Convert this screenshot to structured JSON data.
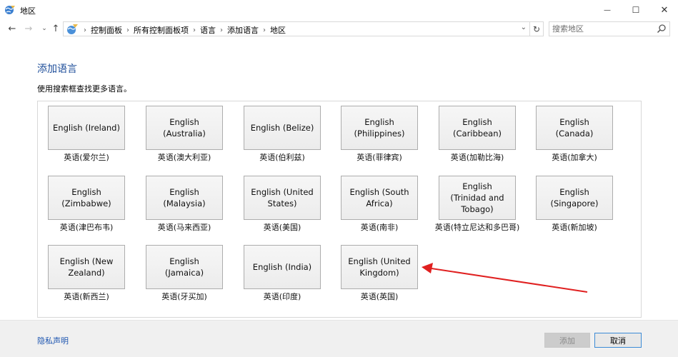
{
  "window": {
    "title": "地区",
    "minimize_glyph": "—",
    "maximize_glyph": "☐",
    "close_glyph": "✕"
  },
  "address_bar": {
    "breadcrumbs": [
      "控制面板",
      "所有控制面板项",
      "语言",
      "添加语言",
      "地区"
    ],
    "search_placeholder": "搜索地区"
  },
  "content": {
    "heading": "添加语言",
    "subtext": "使用搜索框查找更多语言。",
    "languages": [
      {
        "tile": "English (Ireland)",
        "caption": "英语(爱尔兰)"
      },
      {
        "tile": "English (Australia)",
        "caption": "英语(澳大利亚)"
      },
      {
        "tile": "English (Belize)",
        "caption": "英语(伯利兹)"
      },
      {
        "tile": "English (Philippines)",
        "caption": "英语(菲律宾)"
      },
      {
        "tile": "English (Caribbean)",
        "caption": "英语(加勒比海)"
      },
      {
        "tile": "English (Canada)",
        "caption": "英语(加拿大)"
      },
      {
        "tile": "English (Zimbabwe)",
        "caption": "英语(津巴布韦)"
      },
      {
        "tile": "English (Malaysia)",
        "caption": "英语(马来西亚)"
      },
      {
        "tile": "English (United States)",
        "caption": "英语(美国)"
      },
      {
        "tile": "English (South Africa)",
        "caption": "英语(南非)"
      },
      {
        "tile": "English (Trinidad and Tobago)",
        "caption": "英语(特立尼达和多巴哥)"
      },
      {
        "tile": "English (Singapore)",
        "caption": "英语(新加坡)"
      },
      {
        "tile": "English (New Zealand)",
        "caption": "英语(新西兰)"
      },
      {
        "tile": "English (Jamaica)",
        "caption": "英语(牙买加)"
      },
      {
        "tile": "English (India)",
        "caption": "英语(印度)"
      },
      {
        "tile": "English (United Kingdom)",
        "caption": "英语(英国)"
      }
    ]
  },
  "annotation": {
    "arrow_color": "#e02020"
  },
  "footer": {
    "privacy_link": "隐私声明",
    "add_button": "添加",
    "cancel_button": "取消"
  }
}
